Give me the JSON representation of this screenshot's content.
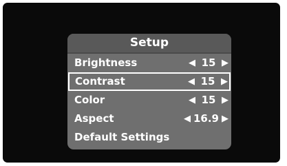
{
  "menu": {
    "title": "Setup",
    "items": [
      {
        "label": "Brightness",
        "value": "15",
        "left_arrow": "◀",
        "right_arrow": "▶",
        "selected": false
      },
      {
        "label": "Contrast",
        "value": "15",
        "left_arrow": "◀",
        "right_arrow": "▶",
        "selected": true
      },
      {
        "label": "Color",
        "value": "15",
        "left_arrow": "◀",
        "right_arrow": "▶",
        "selected": false
      },
      {
        "label": "Aspect",
        "value": "16.9",
        "left_arrow": "◀",
        "right_arrow": "▶",
        "selected": false
      },
      {
        "label": "Default Settings"
      }
    ]
  },
  "colors": {
    "screen": "#0a0a0a",
    "menu_bg": "#6f6f6f",
    "header_bg": "#595959",
    "text": "#ffffff",
    "selection_border": "#ffffff"
  }
}
